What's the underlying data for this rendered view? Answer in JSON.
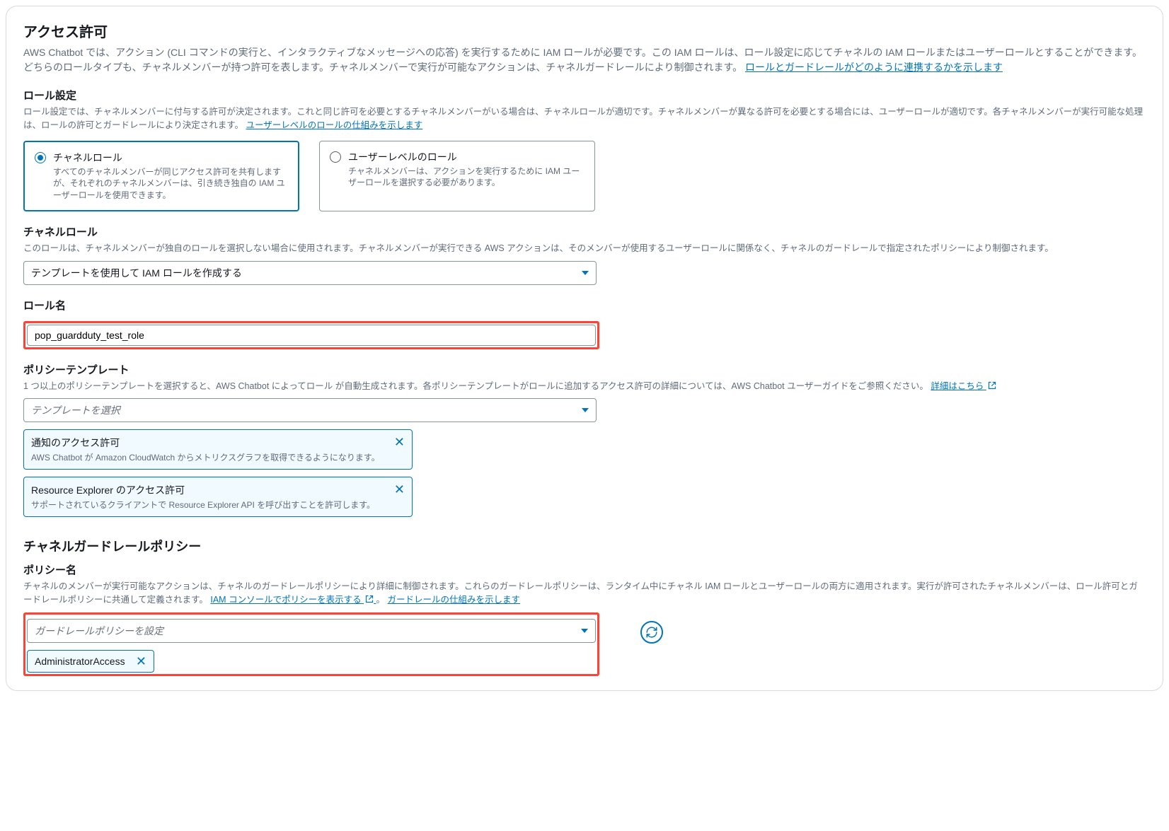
{
  "access": {
    "title": "アクセス許可",
    "desc_prefix": "AWS Chatbot では、アクション (CLI コマンドの実行と、インタラクティブなメッセージへの応答) を実行するために IAM ロールが必要です。この IAM ロールは、ロール設定に応じてチャネルの IAM ロールまたはユーザーロールとすることができます。どちらのロールタイプも、チャネルメンバーが持つ許可を表します。チャネルメンバーで実行が可能なアクションは、チャネルガードレールにより制御されます。",
    "desc_link": "ロールとガードレールがどのように連携するかを示します"
  },
  "role_setting": {
    "title": "ロール設定",
    "desc_prefix": "ロール設定では、チャネルメンバーに付与する許可が決定されます。これと同じ許可を必要とするチャネルメンバーがいる場合は、チャネルロールが適切です。チャネルメンバーが異なる許可を必要とする場合には、ユーザーロールが適切です。各チャネルメンバーが実行可能な処理は、ロールの許可とガードレールにより決定されます。",
    "desc_link": "ユーザーレベルのロールの仕組みを示します",
    "options": {
      "channel": {
        "title": "チャネルロール",
        "desc": "すべてのチャネルメンバーが同じアクセス許可を共有しますが、それぞれのチャネルメンバーは、引き続き独自の IAM ユーザーロールを使用できます。"
      },
      "user": {
        "title": "ユーザーレベルのロール",
        "desc": "チャネルメンバーは、アクションを実行するために IAM ユーザーロールを選択する必要があります。"
      }
    }
  },
  "channel_role": {
    "title": "チャネルロール",
    "desc": "このロールは、チャネルメンバーが独自のロールを選択しない場合に使用されます。チャネルメンバーが実行できる AWS アクションは、そのメンバーが使用するユーザーロールに関係なく、チャネルのガードレールで指定されたポリシーにより制御されます。",
    "select_value": "テンプレートを使用して IAM ロールを作成する"
  },
  "role_name": {
    "title": "ロール名",
    "value": "pop_guardduty_test_role"
  },
  "policy_template": {
    "title": "ポリシーテンプレート",
    "desc_prefix": "1 つ以上のポリシーテンプレートを選択すると、AWS Chatbot によってロール が自動生成されます。各ポリシーテンプレートがロールに追加するアクセス許可の詳細については、AWS Chatbot ユーザーガイドをご参照ください。",
    "desc_link": "詳細はこちら",
    "placeholder": "テンプレートを選択",
    "tokens": [
      {
        "title": "通知のアクセス許可",
        "desc": "AWS Chatbot が Amazon CloudWatch からメトリクスグラフを取得できるようになります。"
      },
      {
        "title": "Resource Explorer のアクセス許可",
        "desc": "サポートされているクライアントで Resource Explorer API を呼び出すことを許可します。"
      }
    ]
  },
  "guardrail": {
    "title": "チャネルガードレールポリシー",
    "policy_name_label": "ポリシー名",
    "desc_prefix": "チャネルのメンバーが実行可能なアクションは、チャネルのガードレールポリシーにより詳細に制御されます。これらのガードレールポリシーは、ランタイム中にチャネル IAM ロールとユーザーロールの両方に適用されます。実行が許可されたチャネルメンバーは、ロール許可とガードレールポリシーに共通して定義されます。",
    "link1": "IAM コンソールでポリシーを表示する",
    "sep": "。",
    "link2": "ガードレールの仕組みを示します",
    "placeholder": "ガードレールポリシーを設定",
    "selected": "AdministratorAccess"
  }
}
